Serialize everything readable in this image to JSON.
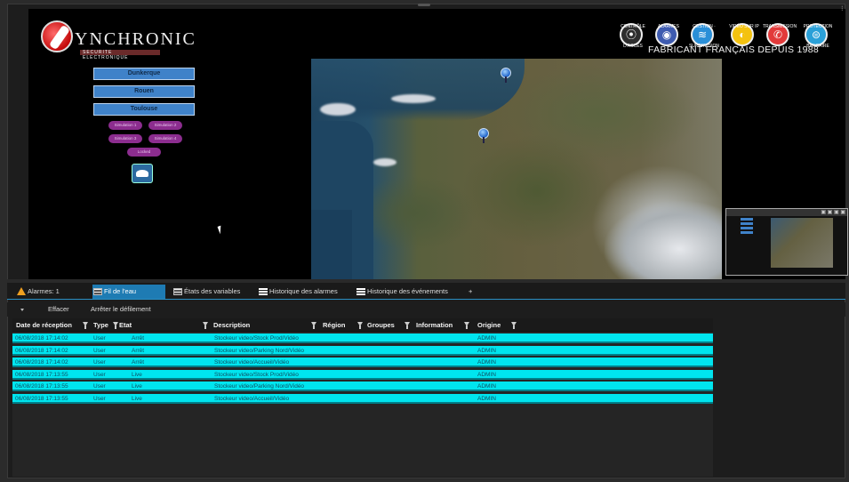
{
  "view": {
    "logo": {
      "name": "YNCHRONIC",
      "tagline": "SECURITE ELECTRONIQUE"
    },
    "brand": {
      "caption": "FABRICANT FRANÇAIS DEPUIS 1988",
      "icons": [
        {
          "label": "CONTRÔLE D'ACCÈS",
          "name": "access-control-icon",
          "color": "#2e2e2e"
        },
        {
          "label": "ALARMES",
          "name": "alarm-icon",
          "color": "#3e5bb0"
        },
        {
          "label": "GESTION · SUPERVISION",
          "name": "supervision-icon",
          "color": "#2a8fd8"
        },
        {
          "label": "VIDÉO SUR IP",
          "name": "video-ip-icon",
          "color": "#f4c20f"
        },
        {
          "label": "TRANSMISSION",
          "name": "transmission-icon",
          "color": "#e23a3a"
        },
        {
          "label": "PROTECTION BANCAIRE",
          "name": "bank-protection-icon",
          "color": "#2aa0d8"
        }
      ]
    },
    "sites": [
      "Dunkerque",
      "Rouen",
      "Toulouse"
    ],
    "simulations": [
      "Simulation 1",
      "Simulation 2",
      "Simulation 3",
      "Simulation 4"
    ],
    "local_btn": "Locked"
  },
  "tabs": [
    {
      "label": "Alarmes: 1"
    },
    {
      "label": "Fil de l'eau"
    },
    {
      "label": "États des variables"
    },
    {
      "label": "Historique des alarmes"
    },
    {
      "label": "Historique des événements"
    },
    {
      "label": "+"
    }
  ],
  "toolbar": {
    "clear": "Effacer",
    "stop_scroll": "Arrêter le défilement"
  },
  "table": {
    "columns": [
      "Date de réception",
      "Type",
      "Etat",
      "Description",
      "Région",
      "Groupes",
      "Information",
      "Origine"
    ],
    "rows": [
      [
        "06/08/2018 17:14:02",
        "User",
        "Arrêt",
        "Stockeur video/Stock Prod/Vidéo",
        "",
        "",
        "",
        "ADMIN"
      ],
      [
        "06/08/2018 17:14:02",
        "User",
        "Arrêt",
        "Stockeur video/Parking Nord/Vidéo",
        "",
        "",
        "",
        "ADMIN"
      ],
      [
        "06/08/2018 17:14:02",
        "User",
        "Arrêt",
        "Stockeur video/Accueil/Vidéo",
        "",
        "",
        "",
        "ADMIN"
      ],
      [
        "06/08/2018 17:13:55",
        "User",
        "Live",
        "Stockeur video/Stock Prod/Vidéo",
        "",
        "",
        "",
        "ADMIN"
      ],
      [
        "06/08/2018 17:13:55",
        "User",
        "Live",
        "Stockeur video/Parking Nord/Vidéo",
        "",
        "",
        "",
        "ADMIN"
      ],
      [
        "06/08/2018 17:13:55",
        "User",
        "Live",
        "Stockeur video/Accueil/Vidéo",
        "",
        "",
        "",
        "ADMIN"
      ]
    ]
  },
  "colors": {
    "accent": "#1e7bb3",
    "row": "#00e5ef",
    "site_button": "#3f82c9",
    "sim_button": "#8c2d8f",
    "warning": "#f0a020"
  }
}
